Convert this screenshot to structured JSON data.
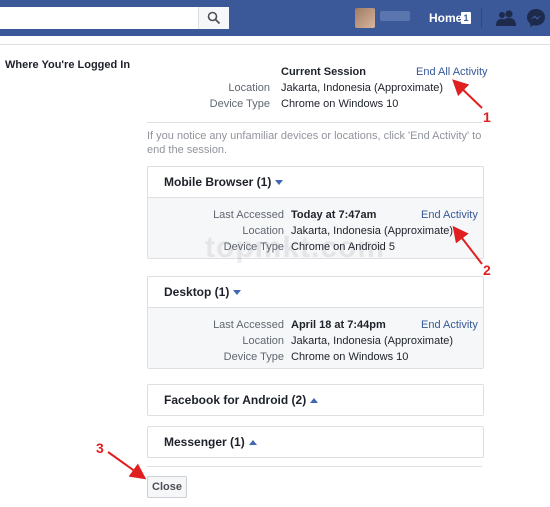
{
  "topbar": {
    "home_label": "Home",
    "home_count": "1",
    "username_blurred": "",
    "colors": {
      "bar": "#3b5998",
      "link": "#365899",
      "annotation": "#e02020"
    },
    "icons": [
      "search-icon",
      "friends-icon",
      "messenger-icon"
    ]
  },
  "section": {
    "label": "Where You're Logged In"
  },
  "current": {
    "title": "Current Session",
    "end_all": "End All Activity",
    "location_label": "Location",
    "location_value": "Jakarta, Indonesia (Approximate)",
    "device_label": "Device Type",
    "device_value": "Chrome on Windows 10"
  },
  "notice": "If you notice any unfamiliar devices or locations, click 'End Activity' to end the session.",
  "cards": [
    {
      "title": "Mobile Browser (1)",
      "last_label": "Last Accessed",
      "last_value": "Today at 7:47am",
      "end": "End Activity",
      "location_label": "Location",
      "location_value": "Jakarta, Indonesia (Approximate)",
      "device_label": "Device Type",
      "device_value": "Chrome on Android 5"
    },
    {
      "title": "Desktop (1)",
      "last_label": "Last Accessed",
      "last_value": "April 18 at 7:44pm",
      "end": "End Activity",
      "location_label": "Location",
      "location_value": "Jakarta, Indonesia (Approximate)",
      "device_label": "Device Type",
      "device_value": "Chrome on Windows 10"
    },
    {
      "title": "Facebook for Android (2)"
    },
    {
      "title": "Messenger (1)"
    }
  ],
  "close_label": "Close",
  "watermark": "topmkt.com",
  "annotations": [
    "1",
    "2",
    "3"
  ]
}
